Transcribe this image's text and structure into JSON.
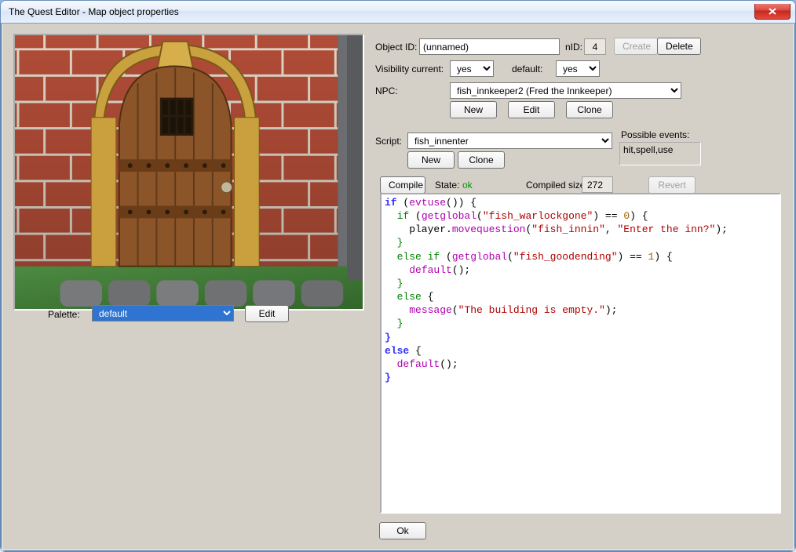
{
  "window": {
    "title": "The Quest Editor - Map object properties"
  },
  "left": {
    "palette_label": "Palette:",
    "palette_selected": "default",
    "edit_label": "Edit"
  },
  "props": {
    "object_id": {
      "label": "Object ID:",
      "value": "(unnamed)",
      "nid_label": "nID:",
      "nid_value": "4",
      "create_label": "Create",
      "delete_label": "Delete"
    },
    "visibility": {
      "label": "Visibility current:",
      "current": "yes",
      "default_label": "default:",
      "default": "yes"
    },
    "npc": {
      "label": "NPC:",
      "selected": "fish_innkeeper2 (Fred the Innkeeper)",
      "new_label": "New",
      "edit_label": "Edit",
      "clone_label": "Clone"
    },
    "script": {
      "label": "Script:",
      "selected": "fish_innenter",
      "new_label": "New",
      "clone_label": "Clone"
    },
    "possible_events": {
      "label": "Possible events:",
      "value": "hit,spell,use"
    }
  },
  "compile": {
    "compile_label": "Compile",
    "state_label": "State:",
    "state_value": "ok",
    "compiled_size_label": "Compiled size:",
    "compiled_size_value": "272",
    "revert_label": "Revert"
  },
  "buttons": {
    "ok": "Ok"
  },
  "code": [
    {
      "t": "if ",
      "cls": "kw-top"
    },
    {
      "t": "("
    },
    {
      "t": "evtuse",
      "cls": "fn"
    },
    {
      "t": "()) {"
    },
    {
      "nl": 1
    },
    {
      "t": "  "
    },
    {
      "t": "if ",
      "cls": "kw-inner"
    },
    {
      "t": "("
    },
    {
      "t": "getglobal",
      "cls": "fn"
    },
    {
      "t": "("
    },
    {
      "t": "\"fish_warlockgone\"",
      "cls": "str"
    },
    {
      "t": ") == "
    },
    {
      "t": "0",
      "cls": "num"
    },
    {
      "t": ") {"
    },
    {
      "nl": 1
    },
    {
      "t": "    player."
    },
    {
      "t": "movequestion",
      "cls": "fn"
    },
    {
      "t": "("
    },
    {
      "t": "\"fish_innin\"",
      "cls": "str"
    },
    {
      "t": ", "
    },
    {
      "t": "\"Enter the inn?\"",
      "cls": "str"
    },
    {
      "t": ");"
    },
    {
      "nl": 1
    },
    {
      "t": "  "
    },
    {
      "t": "}",
      "cls": "kw-inner"
    },
    {
      "nl": 1
    },
    {
      "t": "  "
    },
    {
      "t": "else if ",
      "cls": "kw-inner"
    },
    {
      "t": "("
    },
    {
      "t": "getglobal",
      "cls": "fn"
    },
    {
      "t": "("
    },
    {
      "t": "\"fish_goodending\"",
      "cls": "str"
    },
    {
      "t": ") == "
    },
    {
      "t": "1",
      "cls": "num"
    },
    {
      "t": ") {"
    },
    {
      "nl": 1
    },
    {
      "t": "    "
    },
    {
      "t": "default",
      "cls": "fn"
    },
    {
      "t": "();"
    },
    {
      "nl": 1
    },
    {
      "t": "  "
    },
    {
      "t": "}",
      "cls": "kw-inner"
    },
    {
      "nl": 1
    },
    {
      "t": "  "
    },
    {
      "t": "else ",
      "cls": "kw-inner"
    },
    {
      "t": "{"
    },
    {
      "nl": 1
    },
    {
      "t": "    "
    },
    {
      "t": "message",
      "cls": "fn"
    },
    {
      "t": "("
    },
    {
      "t": "\"The building is empty.\"",
      "cls": "str"
    },
    {
      "t": ");"
    },
    {
      "nl": 1
    },
    {
      "t": "  "
    },
    {
      "t": "}",
      "cls": "kw-inner"
    },
    {
      "nl": 1
    },
    {
      "t": "}",
      "cls": "kw-top"
    },
    {
      "nl": 1
    },
    {
      "t": "else ",
      "cls": "kw-top"
    },
    {
      "t": "{"
    },
    {
      "nl": 1
    },
    {
      "t": "  "
    },
    {
      "t": "default",
      "cls": "fn"
    },
    {
      "t": "();"
    },
    {
      "nl": 1
    },
    {
      "t": "}",
      "cls": "kw-top"
    }
  ]
}
